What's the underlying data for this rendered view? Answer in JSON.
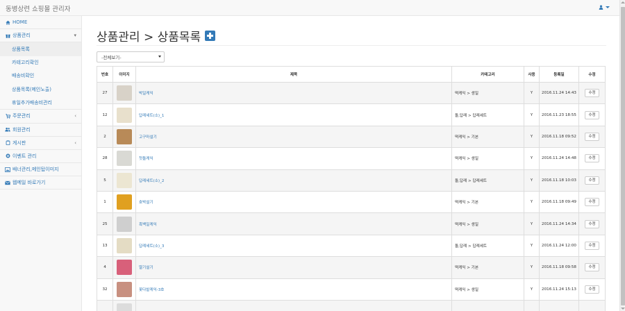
{
  "header": {
    "brand": "동병상련 쇼핑몰 관리자",
    "user_icon": "user-icon"
  },
  "sidebar": {
    "items": [
      {
        "label": "HOME",
        "icon": "home-icon"
      },
      {
        "label": "상품관리",
        "icon": "gift-icon",
        "expanded": true
      },
      {
        "label": "주문관리",
        "icon": "cart-icon"
      },
      {
        "label": "회원관리",
        "icon": "users-icon"
      },
      {
        "label": "게시판",
        "icon": "clipboard-icon"
      },
      {
        "label": "이벤트 관리",
        "icon": "gear-icon"
      },
      {
        "label": "배너관리,메인탑이미지",
        "icon": "picture-icon"
      },
      {
        "label": "웹메일 바로가기",
        "icon": "envelope-icon"
      }
    ],
    "submenu": [
      {
        "label": "상품목록",
        "active": true
      },
      {
        "label": "카테고리확인"
      },
      {
        "label": "배송비확인"
      },
      {
        "label": "상품목록(메인노출)"
      },
      {
        "label": "휴일추가배송비관리"
      }
    ]
  },
  "page": {
    "title": "상품관리 > 상품목록",
    "filter_value": "-전체보기-"
  },
  "table": {
    "headers": [
      "번호",
      "이미지",
      "제목",
      "카테고리",
      "사용",
      "등록일",
      "수정"
    ],
    "edit_label": "수정",
    "rows": [
      {
        "no": "27",
        "title": "박일케익",
        "category": "떡케익 > 생일",
        "use": "Y",
        "date": "2016.11.24 14:43",
        "thumb": "#d8d2c8"
      },
      {
        "no": "12",
        "title": "답례세트(소)_1",
        "category": "돌,답례 > 답례세트",
        "use": "Y",
        "date": "2016.11.23 18:55",
        "thumb": "#e8e0cc"
      },
      {
        "no": "2",
        "title": "고구마설기",
        "category": "떡케익 > 기본",
        "use": "Y",
        "date": "2016.11.18 09:52",
        "thumb": "#b88a58"
      },
      {
        "no": "28",
        "title": "첫돌케익",
        "category": "떡케익 > 생일",
        "use": "Y",
        "date": "2016.11.24 14:48",
        "thumb": "#d9d9d4"
      },
      {
        "no": "5",
        "title": "답례세트(소)_2",
        "category": "돌,답례 > 답례세트",
        "use": "Y",
        "date": "2016.11.18 10:03",
        "thumb": "#ece6d2"
      },
      {
        "no": "1",
        "title": "호박설기",
        "category": "떡케익 > 기본",
        "use": "Y",
        "date": "2016.11.18 09:49",
        "thumb": "#e0a020"
      },
      {
        "no": "25",
        "title": "흑백일케익",
        "category": "떡케익 > 생일",
        "use": "Y",
        "date": "2016.11.24 14:34",
        "thumb": "#cfcfcf"
      },
      {
        "no": "13",
        "title": "답례세트(소)_3",
        "category": "돌,답례 > 답례세트",
        "use": "Y",
        "date": "2016.11.24 12:00",
        "thumb": "#e4dcc4"
      },
      {
        "no": "4",
        "title": "딸기설기",
        "category": "떡케익 > 기본",
        "use": "Y",
        "date": "2016.11.18 09:58",
        "thumb": "#d8607a"
      },
      {
        "no": "32",
        "title": "꽃다발케익-3호",
        "category": "떡케익 > 생일",
        "use": "Y",
        "date": "2016.11.24 15:13",
        "thumb": "#c89080"
      },
      {
        "no": "",
        "title": "",
        "category": "",
        "use": "",
        "date": "",
        "thumb": "#dcdcdc"
      }
    ]
  }
}
